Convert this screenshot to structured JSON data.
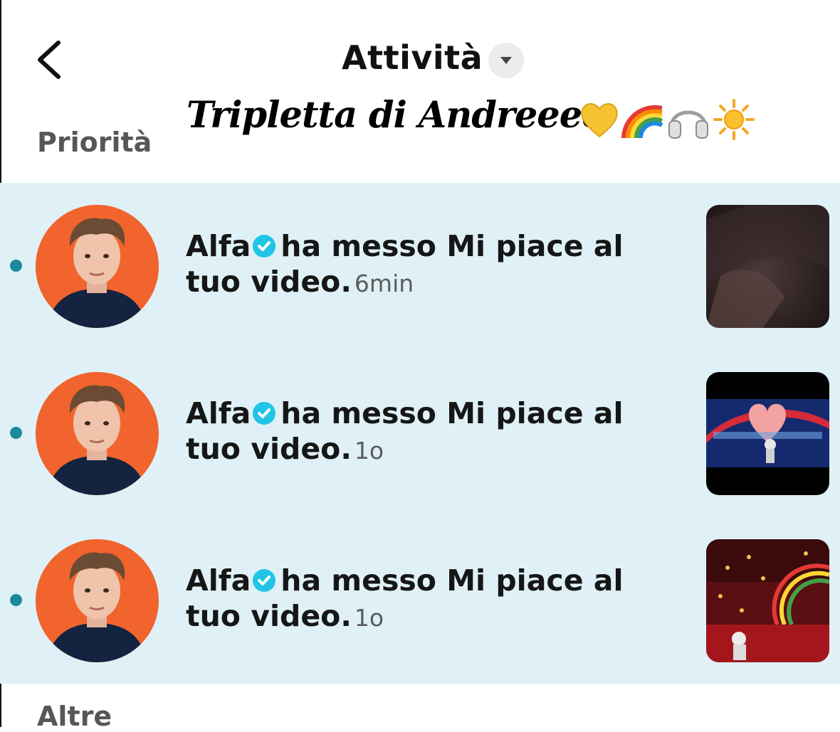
{
  "header": {
    "title": "Attività",
    "caption": "Tripletta di Andreeee",
    "caption_emojis": [
      "yellow-heart",
      "rainbow",
      "headphones",
      "sun"
    ]
  },
  "sections": {
    "priority": "Priorità",
    "other": "Altre"
  },
  "notifications": [
    {
      "user": "Alfa",
      "action": "ha messo Mi piace al tuo video.",
      "time": "6min",
      "unread": true,
      "thumbnail": "dark-video-thumbnail"
    },
    {
      "user": "Alfa",
      "action": "ha messo Mi piace al tuo video.",
      "time": "1o",
      "unread": true,
      "thumbnail": "concert-stage-thumbnail"
    },
    {
      "user": "Alfa",
      "action": "ha messo Mi piace al tuo video.",
      "time": "1o",
      "unread": true,
      "thumbnail": "concert-confetti-thumbnail"
    }
  ],
  "colors": {
    "list_background": "#dff1f6",
    "unread_dot": "#1a8a9a",
    "verified_badge": "#20c4e6",
    "avatar_background": "#f1642e"
  }
}
